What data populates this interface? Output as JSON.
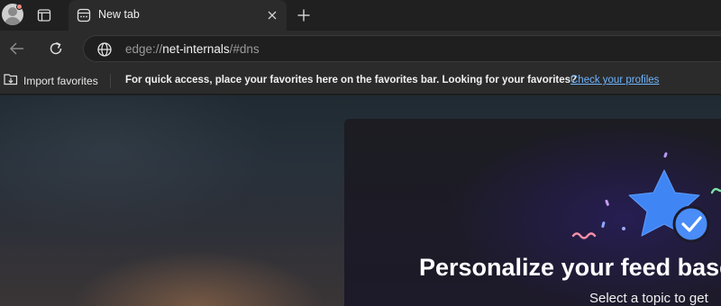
{
  "tab": {
    "title": "New tab"
  },
  "address_bar": {
    "url_prefix": "edge://",
    "url_host": "net-internals",
    "url_suffix": "/#dns"
  },
  "favorites_bar": {
    "import_label": "Import favorites",
    "message": "For quick access, place your favorites here on the favorites bar. Looking for your favorites?",
    "link": "Check your profiles"
  },
  "feed_card": {
    "title": "Personalize your feed base",
    "subtitle": "Select a topic to get"
  },
  "colors": {
    "accent_blue": "#4a8df8",
    "link": "#6fb5ff",
    "background": "#202020"
  },
  "icons": [
    "profile-icon",
    "tab-actions-icon",
    "newtab-favicon-icon",
    "close-icon",
    "plus-icon",
    "back-arrow-icon",
    "refresh-icon",
    "globe-icon",
    "import-favorites-icon",
    "star-badge-icon"
  ]
}
